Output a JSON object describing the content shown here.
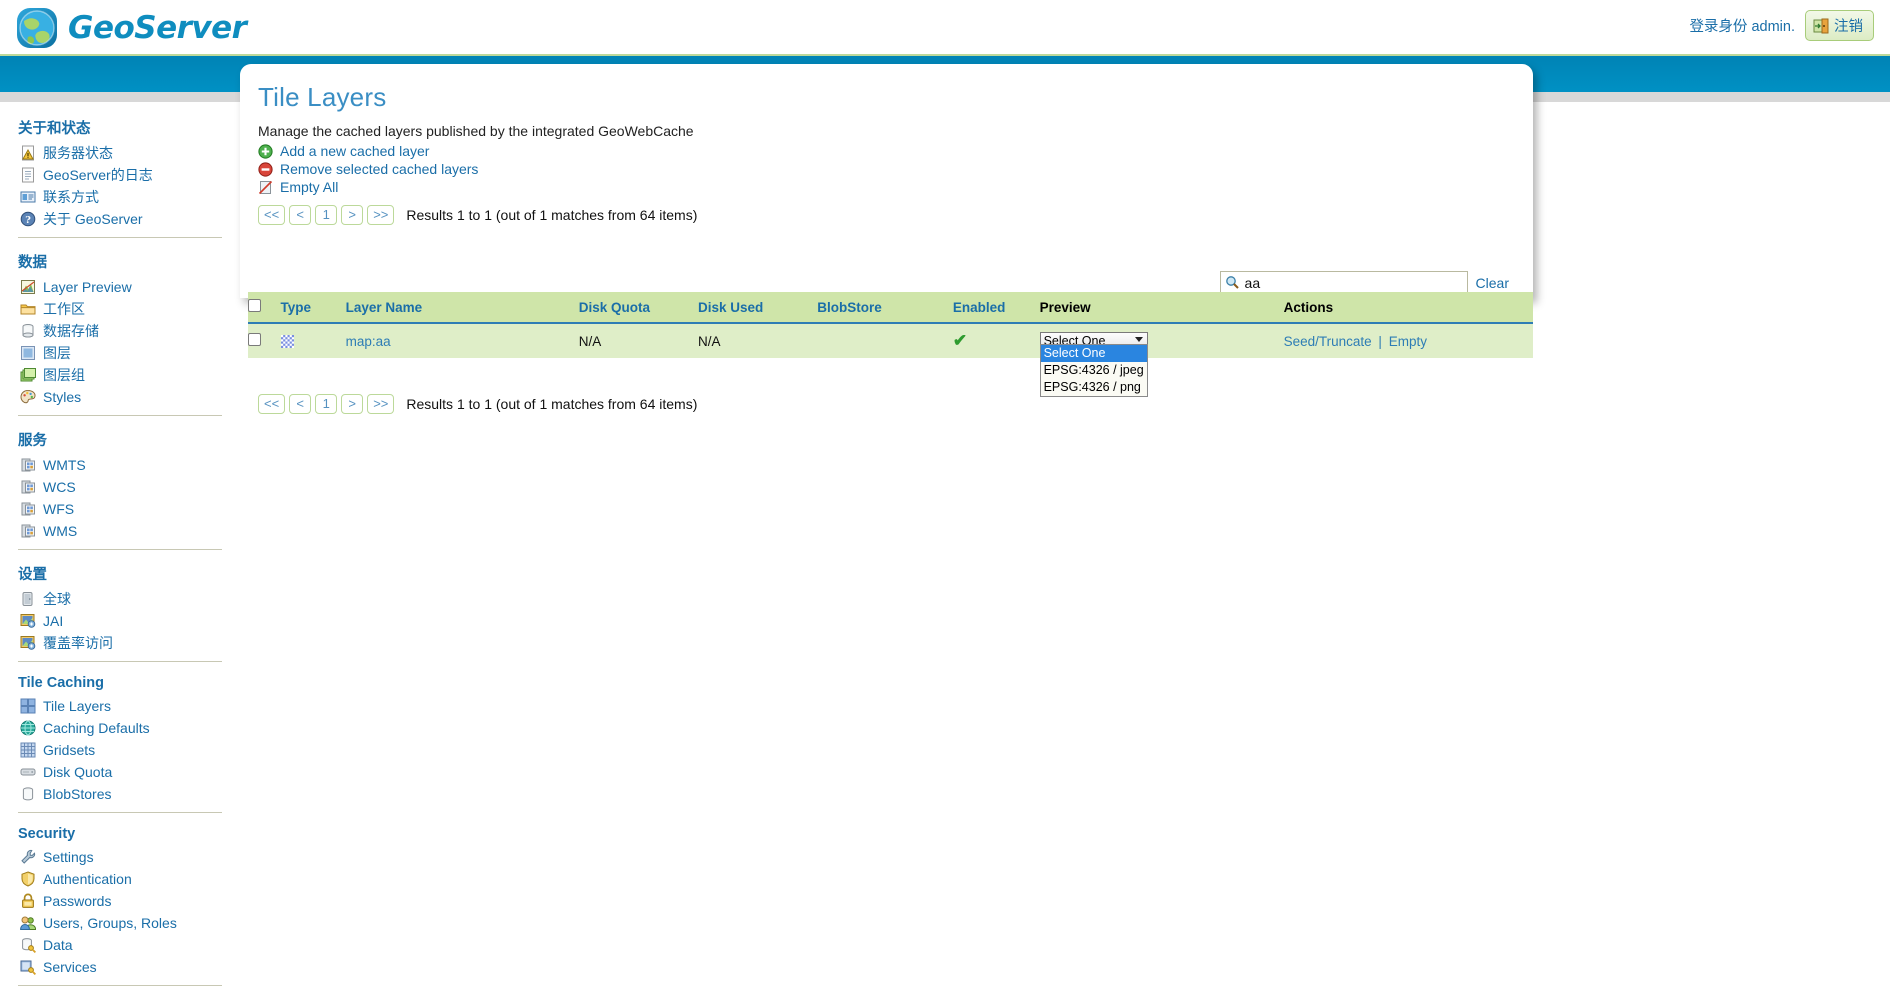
{
  "header": {
    "brand": "GeoServer",
    "logo_icon": "globe-icon",
    "login_text": "登录身份 admin.",
    "logout_label": "注销",
    "logout_icon": "logout-door-icon"
  },
  "sidebar": {
    "groups": [
      {
        "title": "关于和状态",
        "items": [
          {
            "label": "服务器状态",
            "icon": "server-status-icon"
          },
          {
            "label": "GeoServer的日志",
            "icon": "document-icon"
          },
          {
            "label": "联系方式",
            "icon": "contact-card-icon"
          },
          {
            "label": "关于 GeoServer",
            "icon": "info-icon"
          }
        ]
      },
      {
        "title": "数据",
        "items": [
          {
            "label": "Layer Preview",
            "icon": "layer-preview-icon"
          },
          {
            "label": "工作区",
            "icon": "folder-icon"
          },
          {
            "label": "数据存储",
            "icon": "database-icon"
          },
          {
            "label": "图层",
            "icon": "layer-icon"
          },
          {
            "label": "图层组",
            "icon": "layer-group-icon"
          },
          {
            "label": "Styles",
            "icon": "palette-icon"
          }
        ]
      },
      {
        "title": "服务",
        "items": [
          {
            "label": "WMTS",
            "icon": "service-icon"
          },
          {
            "label": "WCS",
            "icon": "service-icon"
          },
          {
            "label": "WFS",
            "icon": "service-icon"
          },
          {
            "label": "WMS",
            "icon": "service-icon"
          }
        ]
      },
      {
        "title": "设置",
        "items": [
          {
            "label": "全球",
            "icon": "global-icon"
          },
          {
            "label": "JAI",
            "icon": "jai-icon"
          },
          {
            "label": "覆盖率访问",
            "icon": "coverage-icon"
          }
        ]
      },
      {
        "title": "Tile Caching",
        "items": [
          {
            "label": "Tile Layers",
            "icon": "tile-layers-icon"
          },
          {
            "label": "Caching Defaults",
            "icon": "caching-defaults-icon"
          },
          {
            "label": "Gridsets",
            "icon": "gridsets-icon"
          },
          {
            "label": "Disk Quota",
            "icon": "disk-quota-icon"
          },
          {
            "label": "BlobStores",
            "icon": "blobstores-icon"
          }
        ]
      },
      {
        "title": "Security",
        "items": [
          {
            "label": "Settings",
            "icon": "wrench-icon"
          },
          {
            "label": "Authentication",
            "icon": "shield-icon"
          },
          {
            "label": "Passwords",
            "icon": "lock-icon"
          },
          {
            "label": "Users, Groups, Roles",
            "icon": "users-icon"
          },
          {
            "label": "Data",
            "icon": "data-key-icon"
          },
          {
            "label": "Services",
            "icon": "services-key-icon"
          }
        ]
      }
    ]
  },
  "main": {
    "title": "Tile Layers",
    "description": "Manage the cached layers published by the integrated GeoWebCache",
    "commands": [
      {
        "label": "Add a new cached layer",
        "icon": "add-circle-icon"
      },
      {
        "label": "Remove selected cached layers",
        "icon": "remove-circle-icon"
      },
      {
        "label": "Empty All",
        "icon": "empty-all-icon"
      }
    ],
    "pager": {
      "first": "<<",
      "prev": "<",
      "page": "1",
      "next": ">",
      "last": ">>",
      "results": "Results 1 to 1 (out of 1 matches from 64 items)"
    },
    "search": {
      "value": "aa",
      "icon": "search-icon",
      "clear_label": "Clear"
    },
    "table": {
      "headers": [
        {
          "label": "Type",
          "link": true
        },
        {
          "label": "Layer Name",
          "link": true
        },
        {
          "label": "Disk Quota",
          "link": true
        },
        {
          "label": "Disk Used",
          "link": true
        },
        {
          "label": "BlobStore",
          "link": true
        },
        {
          "label": "Enabled",
          "link": true
        },
        {
          "label": "Preview",
          "link": false
        },
        {
          "label": "Actions",
          "link": false
        }
      ],
      "rows": [
        {
          "type_icon": "raster-tile-icon",
          "layer_name": "map:aa",
          "disk_quota": "N/A",
          "disk_used": "N/A",
          "blobstore": "",
          "enabled": "✔",
          "preview_selected": "Select One",
          "preview_options": [
            "Select One",
            "EPSG:4326 / jpeg",
            "EPSG:4326 / png"
          ],
          "action_seed": "Seed/Truncate",
          "action_separator": "|",
          "action_empty": "Empty"
        }
      ]
    }
  },
  "colors": {
    "brand_blue": "#0f8dbf",
    "band_blue": "#0091c4",
    "link_blue": "#1a6ea8",
    "header_green": "#cfe5a9",
    "row_green": "#dfeec8",
    "select_highlight": "#2a85e0",
    "check_green": "#2e9b2e"
  }
}
